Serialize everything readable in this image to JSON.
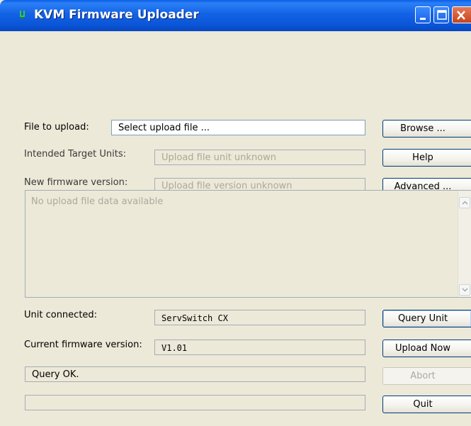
{
  "window": {
    "title": "KVM Firmware Uploader"
  },
  "form": {
    "file_label": "File to upload:",
    "file_value": "Select upload file ...",
    "targets_label": "Intended Target Units:",
    "targets_value": "Upload file unit unknown",
    "version_label": "New firmware version:",
    "version_value": "Upload file version unknown",
    "data_text": "No upload file data available",
    "unit_label": "Unit connected:",
    "unit_value": "ServSwitch CX",
    "current_label": "Current firmware version:",
    "current_value": "V1.01",
    "status_text": "Query OK.",
    "progress_text": ""
  },
  "buttons": {
    "browse": "Browse ...",
    "help": "Help",
    "advanced": "Advanced ...",
    "query_unit": "Query Unit",
    "upload_now": "Upload Now",
    "abort": "Abort",
    "quit": "Quit"
  },
  "colors": {
    "titlebar": "#0a55d8",
    "window_bg": "#ece9d8",
    "disabled_text": "#aca899"
  },
  "icons": {
    "app": "kvm-app-icon",
    "minimize": "minimize-icon",
    "maximize": "maximize-icon",
    "close": "close-icon",
    "scroll_up": "chevron-up-icon",
    "scroll_down": "chevron-down-icon"
  }
}
